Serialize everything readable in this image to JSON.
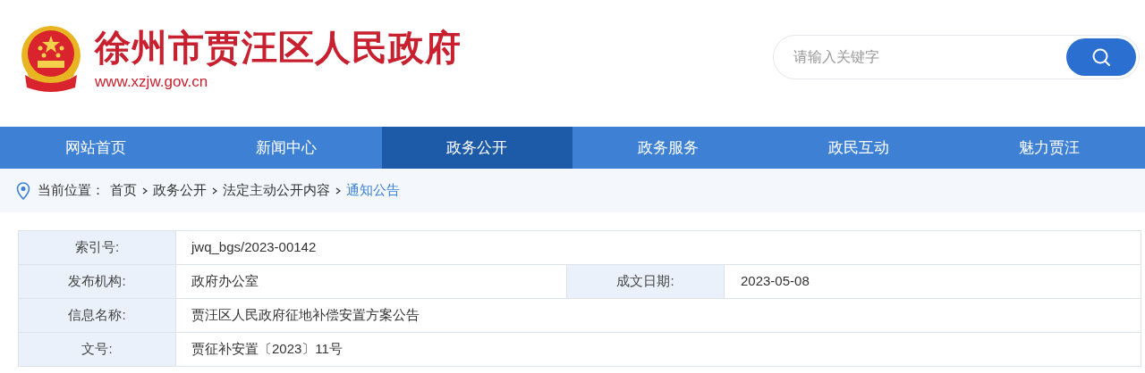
{
  "header": {
    "title": "徐州市贾汪区人民政府",
    "url": "www.xzjw.gov.cn",
    "search": {
      "placeholder": "请输入关键字"
    }
  },
  "nav": [
    {
      "label": "网站首页",
      "selected": false
    },
    {
      "label": "新闻中心",
      "selected": false
    },
    {
      "label": "政务公开",
      "selected": true
    },
    {
      "label": "政务服务",
      "selected": false
    },
    {
      "label": "政民互动",
      "selected": false
    },
    {
      "label": "魅力贾汪",
      "selected": false
    }
  ],
  "breadcrumb": {
    "prefix": "当前位置：",
    "items": [
      {
        "label": "首页",
        "current": false
      },
      {
        "label": "政务公开",
        "current": false
      },
      {
        "label": "法定主动公开内容",
        "current": false
      },
      {
        "label": "通知公告",
        "current": true
      }
    ]
  },
  "info_table": {
    "rows": [
      {
        "pairs": [
          {
            "label": "索引号:",
            "value": "jwq_bgs/2023-00142"
          }
        ]
      },
      {
        "pairs": [
          {
            "label": "发布机构:",
            "value": "政府办公室"
          },
          {
            "label": "成文日期:",
            "value": "2023-05-08"
          }
        ]
      },
      {
        "pairs": [
          {
            "label": "信息名称:",
            "value": "贾汪区人民政府征地补偿安置方案公告"
          }
        ]
      },
      {
        "pairs": [
          {
            "label": "文号:",
            "value": "贾征补安置〔2023〕11号"
          }
        ]
      }
    ]
  }
}
